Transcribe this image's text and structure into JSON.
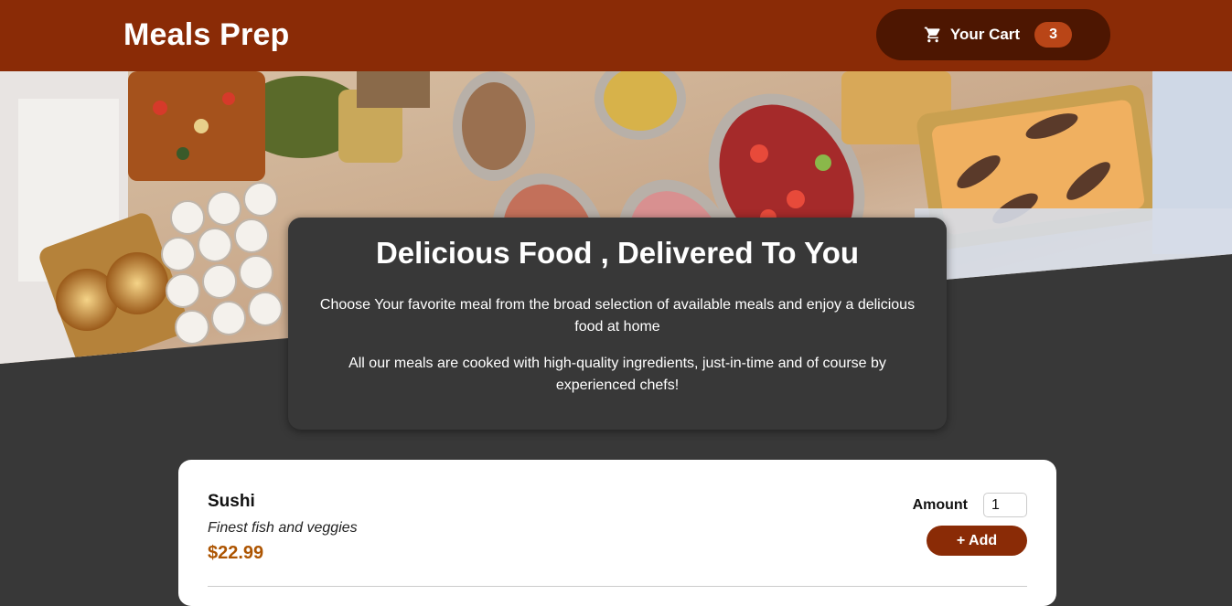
{
  "header": {
    "brand": "Meals Prep",
    "cart_label": "Your Cart",
    "cart_count": "3",
    "cart_icon": "cart-icon"
  },
  "summary": {
    "title": "Delicious Food , Delivered To You",
    "paragraph1": "Choose Your favorite meal from the broad selection of available meals and enjoy a delicious food at home",
    "paragraph2": "All our meals are cooked with high-quality ingredients, just-in-time and of course by experienced chefs!"
  },
  "meals": [
    {
      "name": "Sushi",
      "description": "Finest fish and veggies",
      "price": "$22.99",
      "amount_label": "Amount",
      "amount_value": "1",
      "add_label": "+ Add"
    }
  ],
  "colors": {
    "header_bg": "#8a2b06",
    "cart_bg": "#4d1601",
    "badge_bg": "#b94517",
    "page_bg": "#383838",
    "price": "#ad5502"
  }
}
